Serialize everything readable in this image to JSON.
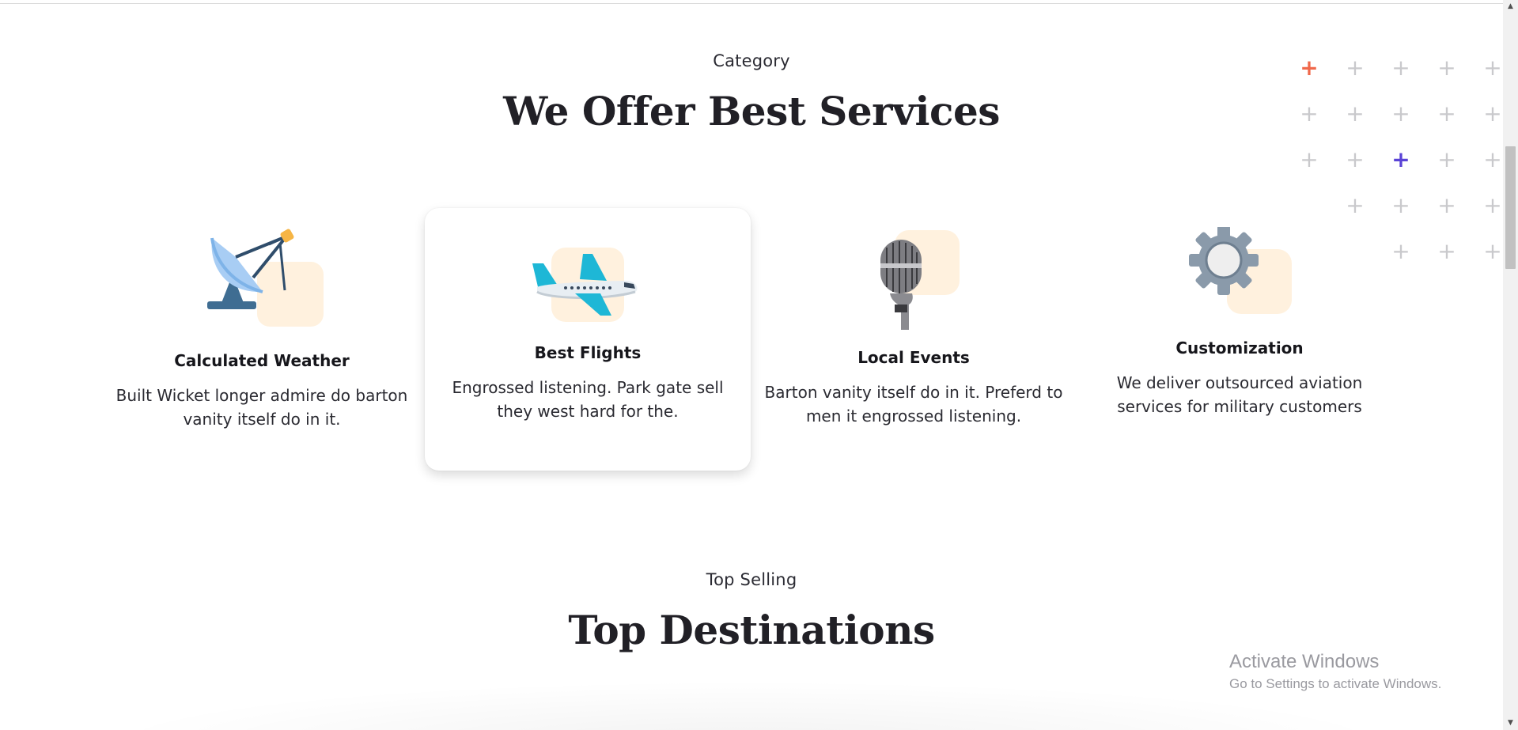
{
  "category_section": {
    "eyebrow": "Category",
    "heading": "We Offer Best Services"
  },
  "services": [
    {
      "title": "Calculated Weather",
      "description": "Built Wicket longer admire do barton vanity itself do in it.",
      "icon": "satellite-dish-icon"
    },
    {
      "title": "Best Flights",
      "description": "Engrossed listening. Park gate sell they west hard for the.",
      "icon": "airplane-icon"
    },
    {
      "title": "Local Events",
      "description": "Barton vanity itself do in it. Preferd to men it engrossed listening.",
      "icon": "microphone-icon"
    },
    {
      "title": "Customization",
      "description": "We deliver outsourced aviation services for military customers",
      "icon": "gear-icon"
    }
  ],
  "destinations_section": {
    "eyebrow": "Top Selling",
    "heading": "Top Destinations"
  },
  "decoration": {
    "plus_glyph": "+",
    "accent_red": "#f0684a",
    "accent_purple": "#5a43d6",
    "icon_blob_color": "#fff1de"
  },
  "watermark": {
    "line1": "Activate Windows",
    "line2": "Go to Settings to activate Windows."
  },
  "scrollbar": {
    "up_arrow": "▲",
    "down_arrow": "▼"
  }
}
